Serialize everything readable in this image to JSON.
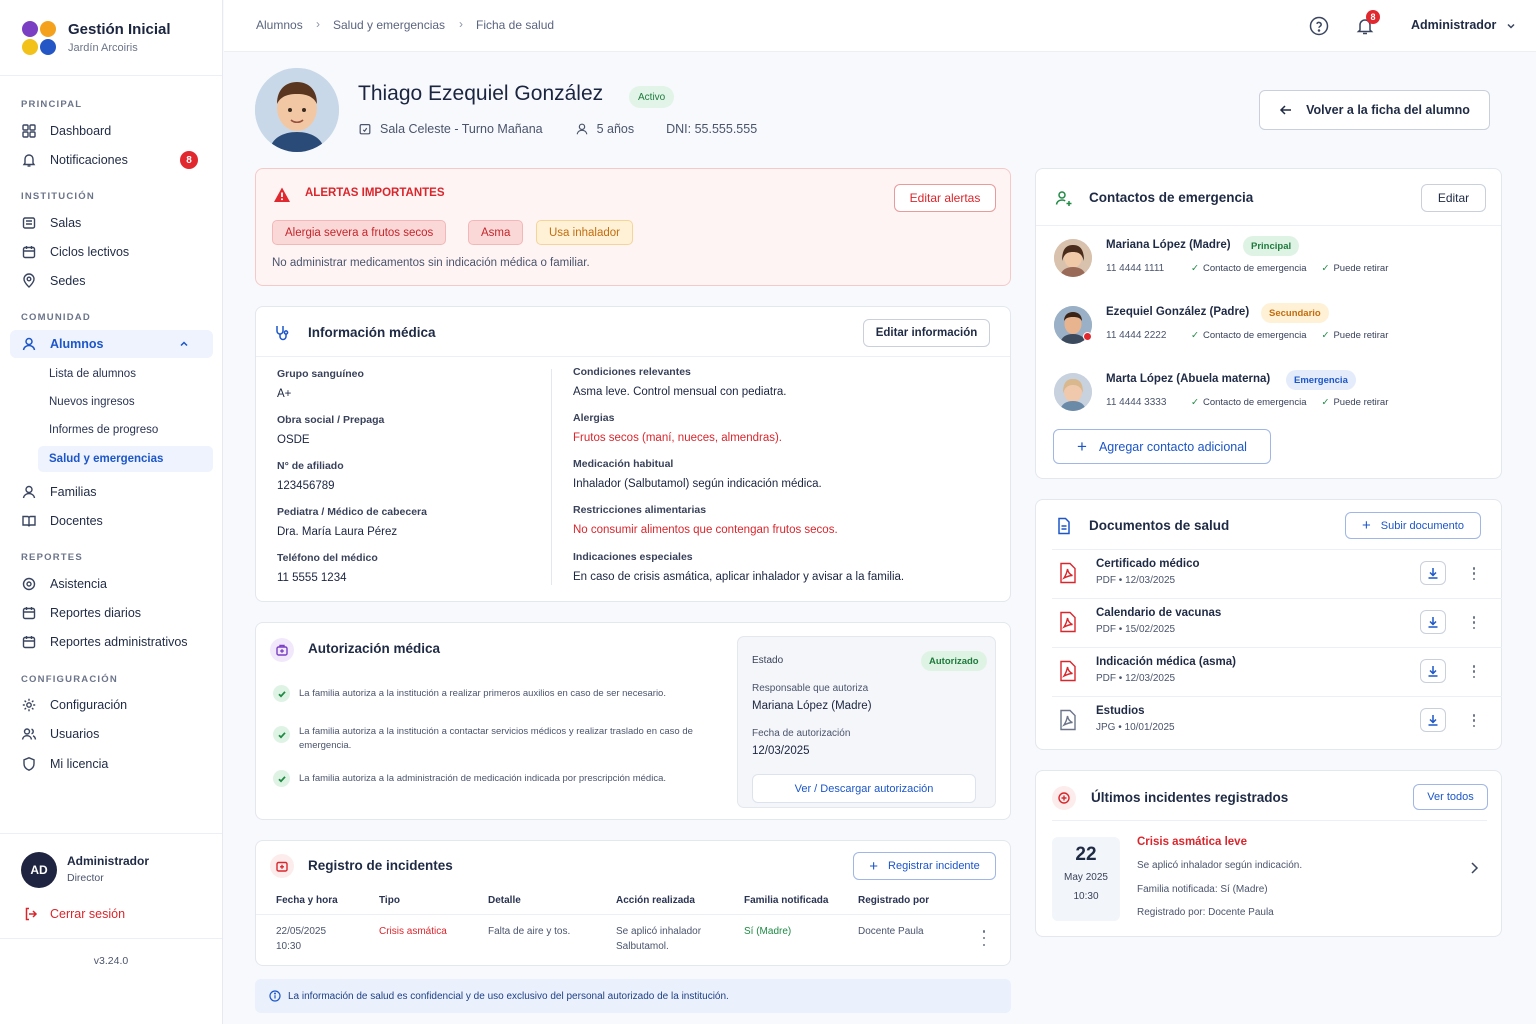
{
  "app": {
    "title": "Gestión Inicial",
    "subtitle": "Jardín Arcoiris",
    "version": "v3.24.0"
  },
  "sidebar": {
    "sections": {
      "principal": "PRINCIPAL",
      "institucion": "INSTITUCIÓN",
      "comunidad": "COMUNIDAD",
      "reportes": "REPORTES",
      "configuracion": "CONFIGURACIÓN"
    },
    "items": {
      "dashboard": "Dashboard",
      "notificaciones": "Notificaciones",
      "notif_count": "8",
      "salas": "Salas",
      "ciclos": "Ciclos lectivos",
      "sedes": "Sedes",
      "alumnos": "Alumnos",
      "lista": "Lista de alumnos",
      "nuevos": "Nuevos ingresos",
      "informes": "Informes de progreso",
      "salud": "Salud y emergencias",
      "familias": "Familias",
      "docentes": "Docentes",
      "asistencia": "Asistencia",
      "diarios": "Reportes diarios",
      "administrativos": "Reportes administrativos",
      "config": "Configuración",
      "usuarios": "Usuarios",
      "licencia": "Mi licencia"
    },
    "user": {
      "initials": "AD",
      "name": "Administrador",
      "role": "Director",
      "logout": "Cerrar sesión"
    }
  },
  "topbar": {
    "crumbs": [
      "Alumnos",
      "Salud y emergencias",
      "Ficha de salud"
    ],
    "bell_count": "8",
    "user": "Administrador"
  },
  "student": {
    "name": "Thiago Ezequiel González",
    "status": "Activo",
    "sala": "Sala Celeste - Turno Mañana",
    "age": "5 años",
    "dni": "DNI: 55.555.555",
    "back": "Volver a la ficha del alumno"
  },
  "alerts": {
    "title": "ALERTAS IMPORTANTES",
    "edit": "Editar alertas",
    "tags": [
      "Alergia severa a frutos secos",
      "Asma",
      "Usa inhalador"
    ],
    "note": "No administrar medicamentos sin indicación médica o familiar."
  },
  "medical": {
    "title": "Información médica",
    "edit": "Editar información",
    "left": [
      {
        "label": "Grupo sanguíneo",
        "value": "A+"
      },
      {
        "label": "Obra social / Prepaga",
        "value": "OSDE"
      },
      {
        "label": "N° de afiliado",
        "value": "123456789"
      },
      {
        "label": "Pediatra / Médico de cabecera",
        "value": "Dra. María Laura Pérez"
      },
      {
        "label": "Teléfono del médico",
        "value": "11 5555 1234"
      }
    ],
    "right": [
      {
        "label": "Condiciones relevantes",
        "value": "Asma leve. Control mensual con pediatra."
      },
      {
        "label": "Alergias",
        "value": "Frutos secos (maní, nueces, almendras)."
      },
      {
        "label": "Medicación habitual",
        "value": "Inhalador (Salbutamol) según indicación médica."
      },
      {
        "label": "Restricciones alimentarias",
        "value": "No consumir alimentos que contengan frutos secos."
      },
      {
        "label": "Indicaciones especiales",
        "value": "En caso de crisis asmática, aplicar inhalador y avisar a la familia."
      }
    ]
  },
  "authorization": {
    "title": "Autorización médica",
    "items": [
      "La familia autoriza a la institución a realizar primeros auxilios en caso de ser necesario.",
      "La familia autoriza a la institución a contactar servicios médicos y realizar traslado en caso de emergencia.",
      "La familia autoriza a la administración de medicación indicada por prescripción médica."
    ],
    "estado_label": "Estado",
    "estado": "Autorizado",
    "resp_label": "Responsable que autoriza",
    "resp": "Mariana López (Madre)",
    "fecha_label": "Fecha de autorización",
    "fecha": "12/03/2025",
    "download": "Ver / Descargar autorización"
  },
  "incidents_table": {
    "title": "Registro de incidentes",
    "register": "Registrar incidente",
    "headers": [
      "Fecha y hora",
      "Tipo",
      "Detalle",
      "Acción realizada",
      "Familia notificada",
      "Registrado por"
    ],
    "row": {
      "date": "22/05/2025",
      "time": "10:30",
      "type": "Crisis asmática",
      "detail": "Falta de aire y tos.",
      "action1": "Se aplicó inhalador",
      "action2": "Salbutamol.",
      "notified": "Sí (Madre)",
      "by": "Docente Paula"
    }
  },
  "footer_note": "La información de salud es confidencial y de uso exclusivo del personal autorizado de la institución.",
  "contacts": {
    "title": "Contactos de emergencia",
    "edit": "Editar",
    "add": "Agregar contacto adicional",
    "list": [
      {
        "name": "Mariana López (Madre)",
        "tag": "Principal",
        "phone": "11 4444 1111",
        "c1": "Contacto de emergencia",
        "c2": "Puede retirar"
      },
      {
        "name": "Ezequiel González (Padre)",
        "tag": "Secundario",
        "phone": "11 4444 2222",
        "c1": "Contacto de emergencia",
        "c2": "Puede retirar"
      },
      {
        "name": "Marta López (Abuela materna)",
        "tag": "Emergencia",
        "phone": "11 4444 3333",
        "c1": "Contacto de emergencia",
        "c2": "Puede retirar"
      }
    ]
  },
  "documents": {
    "title": "Documentos de salud",
    "upload": "Subir documento",
    "list": [
      {
        "name": "Certificado médico",
        "type": "PDF",
        "date": "12/03/2025"
      },
      {
        "name": "Calendario de vacunas",
        "type": "PDF",
        "date": "15/02/2025"
      },
      {
        "name": "Indicación médica (asma)",
        "type": "PDF",
        "date": "12/03/2025"
      },
      {
        "name": "Estudios",
        "type": "JPG",
        "date": "10/01/2025"
      }
    ]
  },
  "last_incidents": {
    "title": "Últimos incidentes registrados",
    "see_all": "Ver todos",
    "day": "22",
    "month": "May 2025",
    "time": "10:30",
    "name": "Crisis asmática leve",
    "l1": "Se aplicó inhalador según indicación.",
    "l2": "Familia notificada: Sí (Madre)",
    "l3": "Registrado por: Docente Paula"
  }
}
